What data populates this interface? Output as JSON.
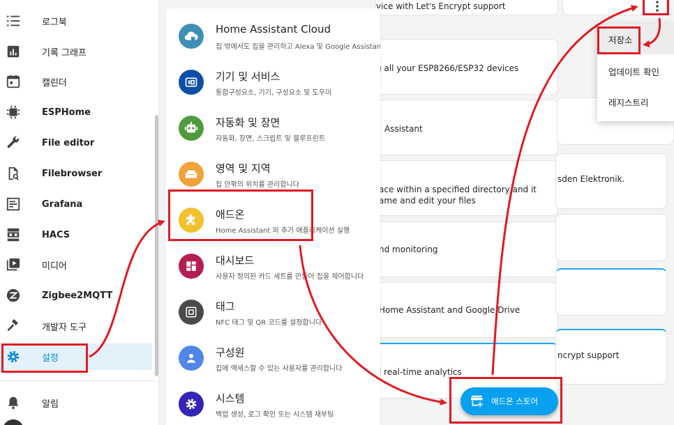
{
  "sidebar": {
    "items": [
      {
        "label": "로그북",
        "icon": "logbook-icon"
      },
      {
        "label": "기록 그래프",
        "icon": "history-graph-icon"
      },
      {
        "label": "캘린더",
        "icon": "calendar-icon"
      },
      {
        "label": "ESPHome",
        "icon": "esphome-icon"
      },
      {
        "label": "File editor",
        "icon": "wrench-icon"
      },
      {
        "label": "Filebrowser",
        "icon": "file-search-icon"
      },
      {
        "label": "Grafana",
        "icon": "chart-box-icon"
      },
      {
        "label": "HACS",
        "icon": "hacs-icon"
      },
      {
        "label": "미디어",
        "icon": "media-icon"
      },
      {
        "label": "Zigbee2MQTT",
        "icon": "zigbee-icon"
      },
      {
        "label": "개발자 도구",
        "icon": "hammer-icon"
      },
      {
        "label": "설정",
        "icon": "gear-icon",
        "active": true
      },
      {
        "label": "알림",
        "icon": "bell-icon"
      }
    ]
  },
  "settings_menu": {
    "items": [
      {
        "title": "Home Assistant Cloud",
        "subtitle": "집 밖에서도 집을 관리하고 Alexa 및 Google Assistant와 연동",
        "color": "#3d8fb6",
        "icon": "cloud-lock-icon"
      },
      {
        "title": "기기 및 서비스",
        "subtitle": "통합구성요소, 기기, 구성요소 및 도우미",
        "color": "#0d4ea8",
        "icon": "devices-icon"
      },
      {
        "title": "자동화 및 장면",
        "subtitle": "자동화, 장면, 스크립트 및 블루프린트",
        "color": "#4f9a3d",
        "icon": "robot-icon"
      },
      {
        "title": "영역 및 지역",
        "subtitle": "집 안팎의 위치를 관리합니다",
        "color": "#f0a33a",
        "icon": "sofa-icon"
      },
      {
        "title": "애드온",
        "subtitle": "Home Assistant 외 추가 애플리케이션 실행",
        "color": "#f2c12e",
        "icon": "puzzle-icon"
      },
      {
        "title": "대시보드",
        "subtitle": "사용자 정의된 카드 세트를 만들어 집을 제어합니다",
        "color": "#b41f4e",
        "icon": "dashboard-icon"
      },
      {
        "title": "태그",
        "subtitle": "NFC 태그 및 QR 코드를 설정합니다",
        "color": "#4a4a4a",
        "icon": "nfc-icon"
      },
      {
        "title": "구성원",
        "subtitle": "집에 액세스할 수 있는 사용자를 관리합니다",
        "color": "#5087e8",
        "icon": "person-icon"
      },
      {
        "title": "시스템",
        "subtitle": "백업 생성, 로그 확인 또는 시스템 재부팅",
        "color": "#3424b8",
        "icon": "gear-icon"
      }
    ]
  },
  "background_cards": [
    {
      "lines": [
        "vice with Let's Encrypt support"
      ]
    },
    {
      "lines": [
        "g all your ESP8266/ESP32 devices"
      ]
    },
    {
      "lines": [
        "Assistant"
      ]
    },
    {
      "lines": [
        "ace within a specified directory and it",
        "ame and edit your files"
      ]
    },
    {
      "lines": [
        "nd monitoring"
      ]
    },
    {
      "lines": [
        "Home Assistant and Google Drive"
      ]
    },
    {
      "lines": [
        "l real-time analytics"
      ]
    },
    {
      "lines": [
        "sden Elektronik."
      ]
    },
    {
      "lines": [
        "ncrypt support"
      ]
    }
  ],
  "dropdown": {
    "items": [
      "저장소",
      "업데이트 확인",
      "레지스트리"
    ]
  },
  "fab": {
    "label": "애드온 스토어",
    "icon": "store-plus-icon"
  },
  "colors": {
    "accent": "#0aa0f0",
    "annotation_red": "#e01a22",
    "active_bg": "#e3f1fb"
  }
}
